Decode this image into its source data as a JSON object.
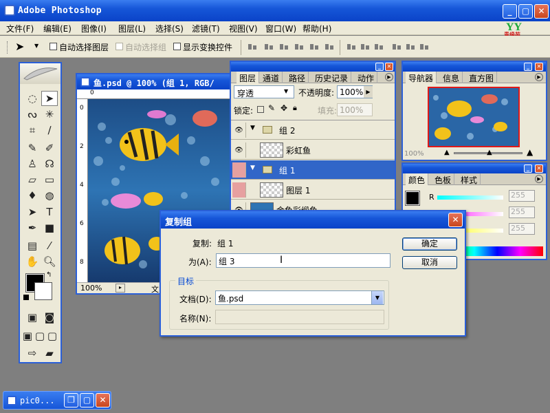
{
  "app": {
    "title": "Adobe Photoshop"
  },
  "brand": {
    "mark": "YY",
    "text": "青缘苑"
  },
  "menu": [
    "文件(F)",
    "编辑(E)",
    "图像(I)",
    "图层(L)",
    "选择(S)",
    "滤镜(T)",
    "视图(V)",
    "窗口(W)",
    "帮助(H)"
  ],
  "options": {
    "auto_select_layer": "自动选择图层",
    "auto_select_group": "自动选择组",
    "show_transform": "显示变换控件"
  },
  "document": {
    "title": "鱼.psd @ 100% (组 1, RGB/",
    "zoom": "100%",
    "status_tail": "文",
    "ruler_h": [
      "0"
    ],
    "ruler_v": [
      "0",
      "2",
      "4",
      "6",
      "8"
    ]
  },
  "layers_panel": {
    "tabs": [
      "图层",
      "通道",
      "路径",
      "历史记录",
      "动作"
    ],
    "blend_mode": "穿透",
    "opacity_label": "不透明度:",
    "opacity_value": "100%",
    "lock_label": "锁定:",
    "fill_label": "填充:",
    "fill_value": "100%",
    "rows": [
      {
        "name": "组 2",
        "kind": "group"
      },
      {
        "name": "彩虹鱼",
        "kind": "layer"
      },
      {
        "name": "组 1",
        "kind": "group",
        "selected": true
      },
      {
        "name": "图层 1",
        "kind": "layer"
      },
      {
        "name": "金鱼彩缎鱼",
        "kind": "layer"
      }
    ]
  },
  "navigator_panel": {
    "tabs": [
      "导航器",
      "信息",
      "直方图"
    ],
    "zoom": "100%"
  },
  "color_panel": {
    "tabs": [
      "颜色",
      "色板",
      "样式"
    ],
    "r_label": "R",
    "values": [
      "255",
      "255",
      "255"
    ]
  },
  "dialog": {
    "title": "复制组",
    "copy_label": "复制:",
    "copy_value": "组 1",
    "as_label": "为(A):",
    "as_value": "组 3",
    "target_legend": "目标",
    "doc_label": "文档(D):",
    "doc_value": "鱼.psd",
    "name_label": "名称(N):",
    "ok": "确定",
    "cancel": "取消"
  },
  "taskbar": {
    "item": "pic0..."
  },
  "colors": {
    "xp_blue": "#2a5fd8",
    "selected_row": "#3166c8",
    "dialog_bg": "#ece9d8"
  }
}
